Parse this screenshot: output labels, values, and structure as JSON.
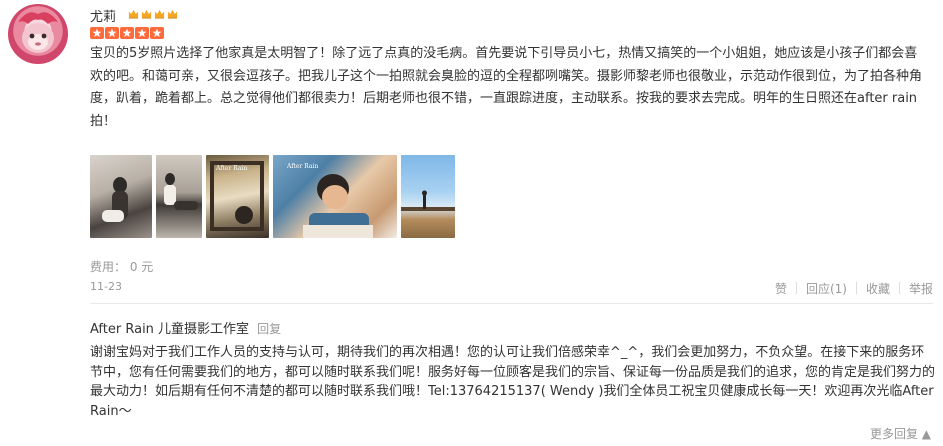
{
  "user": {
    "name": "尤莉",
    "avatar_icon": "pink-monkey-plush-avatar",
    "level_icon": "crown-icon",
    "level_count": 4,
    "rating_stars": 5
  },
  "review": {
    "text": "宝贝的5岁照片选择了他家真是太明智了！除了远了点真的没毛病。首先要说下引导员小七，热情又搞笑的一个小姐姐，她应该是小孩子们都会喜欢的吧。和蔼可亲，又很会逗孩子。把我儿子这个一拍照就会臭脸的逗的全程都咧嘴笑。摄影师黎老师也很敬业，示范动作很到位，为了拍各种角度，趴着，跪着都上。总之觉得他们都很卖力！后期老师也很不错，一直跟踪进度，主动联系。按我的要求去完成。明年的生日照还在after rain拍！",
    "photos": [
      {
        "name": "review-photo-1"
      },
      {
        "name": "review-photo-2"
      },
      {
        "name": "review-photo-3",
        "caption": "After Rain"
      },
      {
        "name": "review-photo-4",
        "caption": "After Rain"
      },
      {
        "name": "review-photo-5"
      }
    ],
    "cost": "费用： 0 元",
    "date": "11-23"
  },
  "actions": {
    "like": "赞",
    "reply": "回应(1)",
    "favorite": "收藏",
    "report": "举报"
  },
  "merchant_reply": {
    "name": "After Rain 儿童摄影工作室",
    "tag": "回复",
    "text": "谢谢宝妈对于我们工作人员的支持与认可，期待我们的再次相遇！您的认可让我们倍感荣幸^_^，我们会更加努力，不负众望。在接下来的服务环节中，您有任何需要我们的地方，都可以随时联系我们呢！服务好每一位顾客是我们的宗旨、保证每一份品质是我们的追求，您的肯定是我们努力的最大动力！如后期有任何不清楚的都可以随时联系我们哦！Tel:13764215137( Wendy )我们全体员工祝宝贝健康成长每一天！欢迎再次光临After Rain～",
    "more": "更多回复 ▲"
  },
  "colors": {
    "star": "#ff6a3d",
    "crown": "#f5a623",
    "muted": "#999999",
    "text": "#333333"
  }
}
